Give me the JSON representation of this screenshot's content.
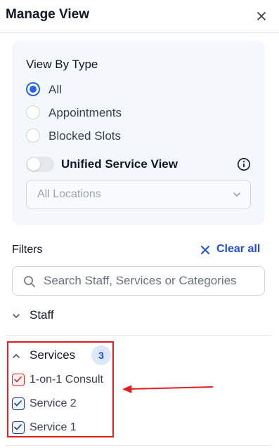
{
  "header": {
    "title": "Manage View"
  },
  "view_by_type": {
    "title": "View By Type",
    "options": [
      {
        "label": "All",
        "selected": true
      },
      {
        "label": "Appointments",
        "selected": false
      },
      {
        "label": "Blocked Slots",
        "selected": false
      }
    ],
    "unified_toggle": {
      "label": "Unified Service View",
      "on": false
    },
    "location_select": {
      "value": "All Locations"
    }
  },
  "filters": {
    "label": "Filters",
    "clear_all": "Clear all",
    "search_placeholder": "Search Staff, Services or Categories"
  },
  "sections": {
    "staff": {
      "label": "Staff",
      "expanded": false
    },
    "services": {
      "label": "Services",
      "count": "3",
      "expanded": true,
      "items": [
        {
          "label": "1-on-1 Consult",
          "checked": true
        },
        {
          "label": "Service 2",
          "checked": true
        },
        {
          "label": "Service 1",
          "checked": true
        }
      ]
    }
  },
  "colors": {
    "accent": "#2563eb",
    "link": "#1d4ed8",
    "annotation": "#e11d1d",
    "panel_bg": "#f4f7fc"
  }
}
